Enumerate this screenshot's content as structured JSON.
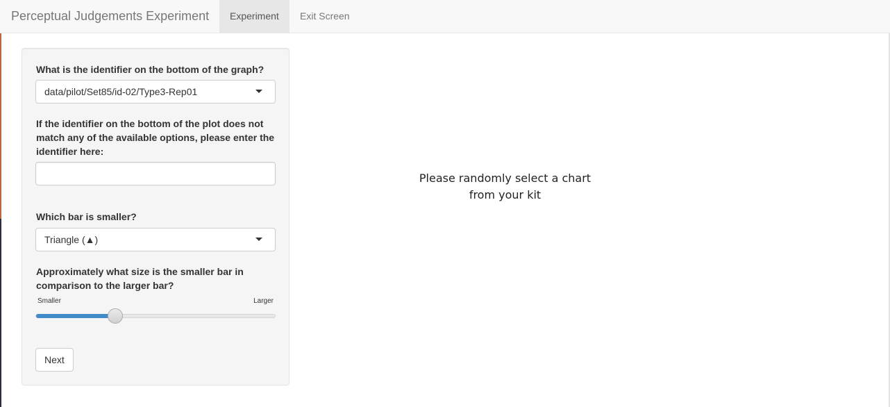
{
  "navbar": {
    "brand": "Perceptual Judgements Experiment",
    "tabs": [
      {
        "label": "Experiment",
        "active": true
      },
      {
        "label": "Exit Screen",
        "active": false
      }
    ]
  },
  "sidebar": {
    "identifier_label": "What is the identifier on the bottom of the graph?",
    "identifier_selected": "data/pilot/Set85/id-02/Type3-Rep01",
    "manual_identifier_label": "If the identifier on the bottom of the plot does not match any of the available options, please enter the identifier here:",
    "manual_identifier_value": "",
    "smaller_bar_label": "Which bar is smaller?",
    "smaller_bar_selected": "Triangle (▲)",
    "size_label": "Approximately what size is the smaller bar in comparison to the larger bar?",
    "slider": {
      "min_label": "Smaller",
      "max_label": "Larger",
      "value_fraction": 0.33
    },
    "next_label": "Next"
  },
  "main": {
    "message": "Please randomly select a chart\nfrom your kit"
  },
  "colors": {
    "accent": "#428bca",
    "navbar_bg": "#f8f8f8",
    "active_tab_bg": "#e7e7e7",
    "well_bg": "#f5f5f5"
  }
}
